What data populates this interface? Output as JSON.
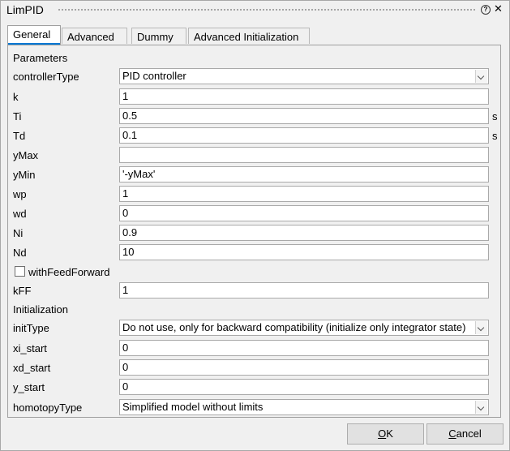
{
  "window": {
    "title": "LimPID"
  },
  "tabs": [
    {
      "label": "General"
    },
    {
      "label": "Advanced"
    },
    {
      "label": "Dummy"
    },
    {
      "label": "Advanced Initialization"
    }
  ],
  "sections": {
    "parameters": "Parameters",
    "initialization": "Initialization"
  },
  "fields": {
    "controllerType": {
      "label": "controllerType",
      "value": "PID controller"
    },
    "k": {
      "label": "k",
      "value": "1"
    },
    "Ti": {
      "label": "Ti",
      "value": "0.5",
      "unit": "s"
    },
    "Td": {
      "label": "Td",
      "value": "0.1",
      "unit": "s"
    },
    "yMax": {
      "label": "yMax",
      "value": ""
    },
    "yMin": {
      "label": "yMin",
      "value": "'-yMax'"
    },
    "wp": {
      "label": "wp",
      "value": "1"
    },
    "wd": {
      "label": "wd",
      "value": "0"
    },
    "Ni": {
      "label": "Ni",
      "value": "0.9"
    },
    "Nd": {
      "label": "Nd",
      "value": "10"
    },
    "withFeedForward": {
      "label": "withFeedForward",
      "checked": false
    },
    "kFF": {
      "label": "kFF",
      "value": "1"
    },
    "initType": {
      "label": "initType",
      "value": "Do not use, only for backward compatibility (initialize only integrator state)"
    },
    "xi_start": {
      "label": "xi_start",
      "value": "0"
    },
    "xd_start": {
      "label": "xd_start",
      "value": "0"
    },
    "y_start": {
      "label": "y_start",
      "value": "0"
    },
    "homotopyType": {
      "label": "homotopyType",
      "value": "Simplified model without limits"
    }
  },
  "buttons": {
    "ok": {
      "label_mnemonic": "O",
      "label_rest": "K"
    },
    "cancel": {
      "label_mnemonic": "C",
      "label_rest": "ancel"
    }
  },
  "icons": {
    "help": "help-icon",
    "close": "close-icon"
  }
}
